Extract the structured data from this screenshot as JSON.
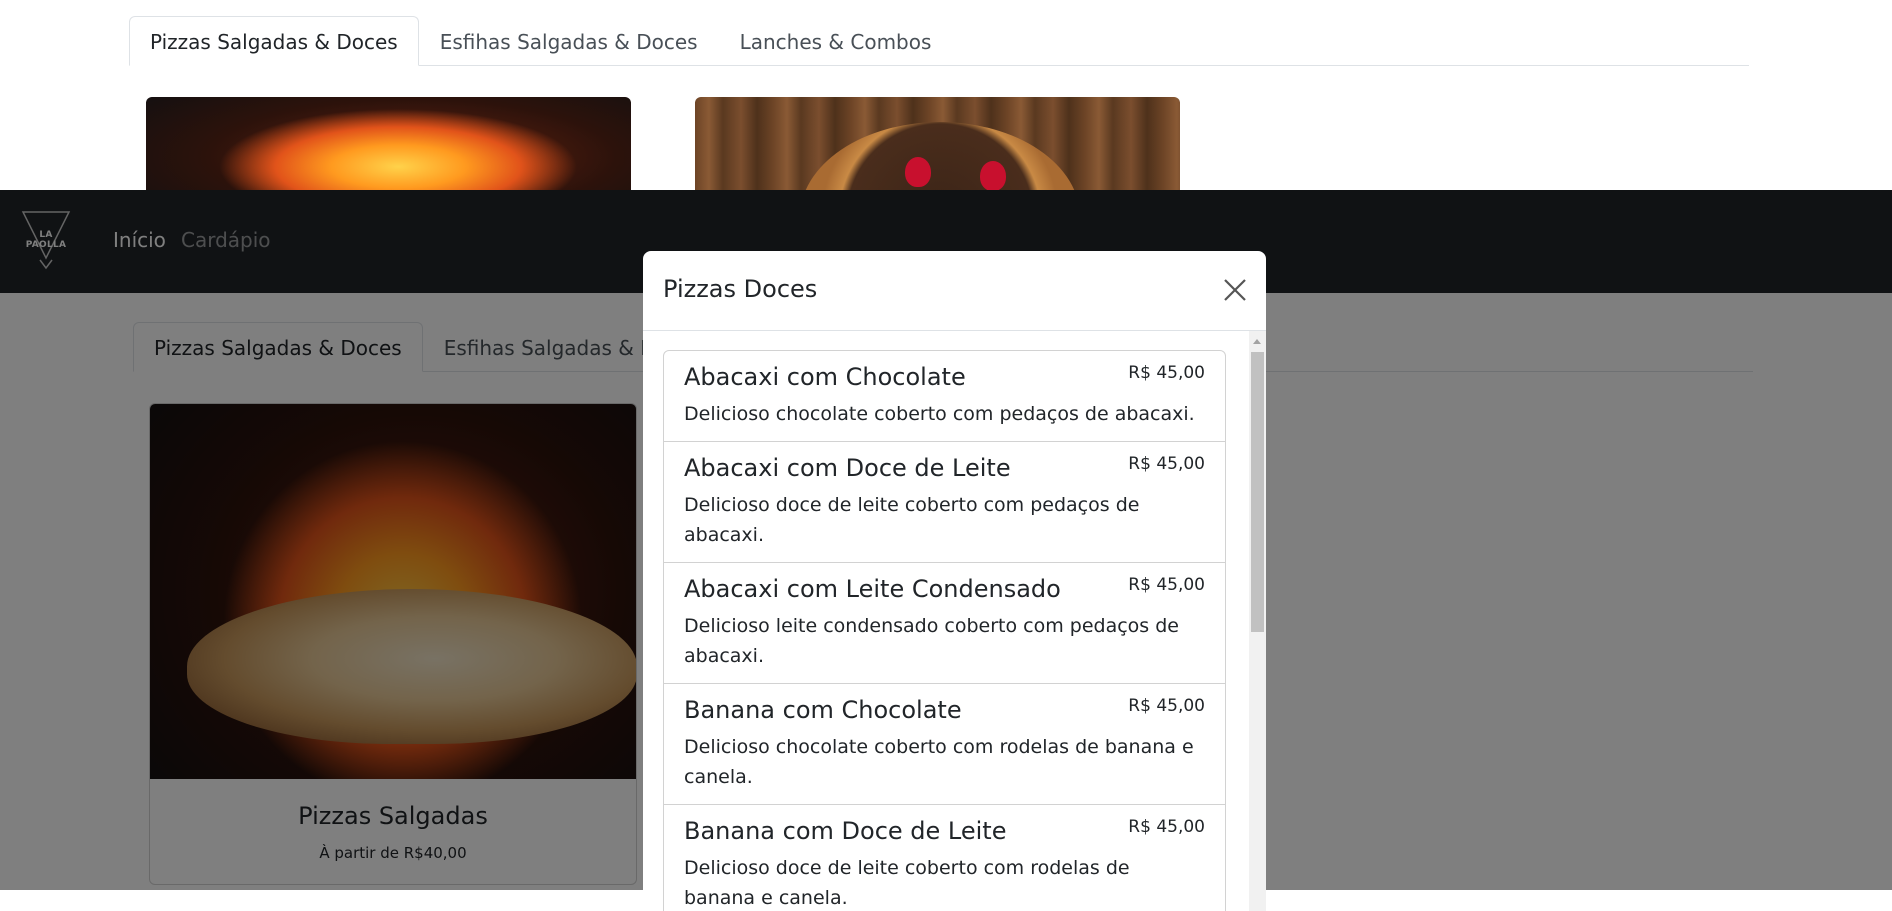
{
  "tabs": [
    {
      "label": "Pizzas Salgadas & Doces",
      "active": true
    },
    {
      "label": "Esfihas Salgadas & Doces",
      "active": false
    },
    {
      "label": "Lanches & Combos",
      "active": false
    }
  ],
  "navbar": {
    "logo_text": "LA PAOLLA",
    "links": [
      {
        "label": "Início",
        "active": true
      },
      {
        "label": "Cardápio",
        "active": false
      }
    ]
  },
  "cards": [
    {
      "title": "Pizzas Salgadas",
      "subtitle": "À partir de R$40,00"
    }
  ],
  "modal": {
    "title": "Pizzas Doces",
    "items": [
      {
        "name": "Abacaxi com Chocolate",
        "price": "R$ 45,00",
        "description": "Delicioso chocolate coberto com pedaços de abacaxi."
      },
      {
        "name": "Abacaxi com Doce de Leite",
        "price": "R$ 45,00",
        "description": "Delicioso doce de leite coberto com pedaços de abacaxi."
      },
      {
        "name": "Abacaxi com Leite Condensado",
        "price": "R$ 45,00",
        "description": "Delicioso leite condensado coberto com pedaços de abacaxi."
      },
      {
        "name": "Banana com Chocolate",
        "price": "R$ 45,00",
        "description": "Delicioso chocolate coberto com rodelas de banana e canela."
      },
      {
        "name": "Banana com Doce de Leite",
        "price": "R$ 45,00",
        "description": "Delicioso doce de leite coberto com rodelas de banana e canela."
      }
    ]
  },
  "colors": {
    "navbar": "#212529",
    "backdrop": "rgba(0,0,0,0.5)",
    "border": "#dee2e6"
  }
}
